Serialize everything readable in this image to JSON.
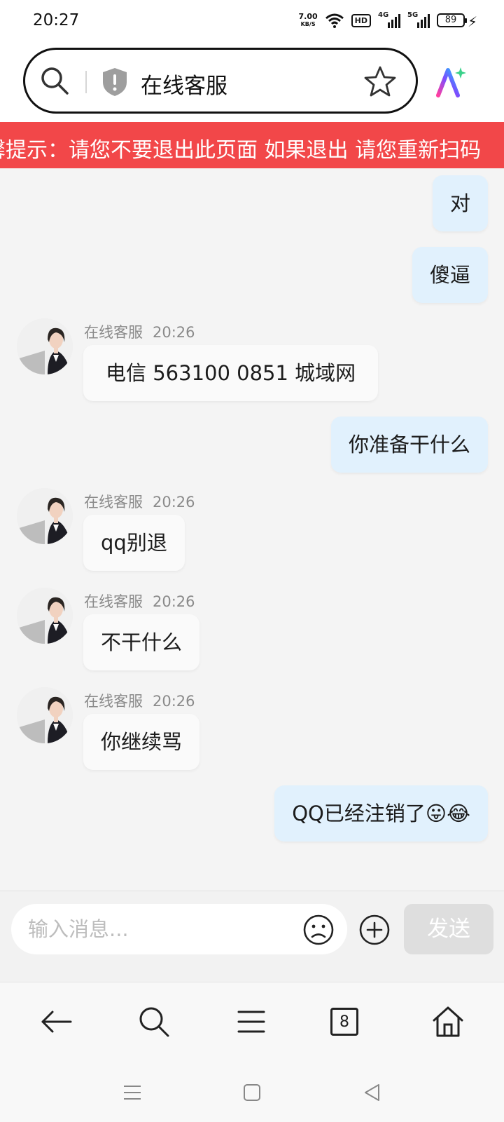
{
  "status_bar": {
    "time": "20:27",
    "net_speed_value": "7.00",
    "net_speed_unit": "KB/S",
    "hd_label": "HD",
    "signal1_label": "4G",
    "signal2_label": "5G",
    "battery": "89"
  },
  "header": {
    "page_title": "在线客服",
    "search_icon": "search-icon",
    "shield_icon": "shield-alert-icon",
    "star_icon": "star-icon",
    "ai_icon": "ai-assistant-icon"
  },
  "marquee": {
    "text": "馨提示：请您不要退出此页面 如果退出 请您重新扫码"
  },
  "colors": {
    "marquee_bg": "#f24749",
    "my_bubble": "#e1f1fd",
    "their_bubble": "#fafafa",
    "send_disabled": "#dedede"
  },
  "chat": {
    "agent_name": "在线客服",
    "messages": [
      {
        "from": "me",
        "text": "对"
      },
      {
        "from": "me",
        "text": "傻逼"
      },
      {
        "from": "agent",
        "name": "在线客服",
        "time": "20:26",
        "text": "电信 563100 0851 城域网"
      },
      {
        "from": "me",
        "text": "你准备干什么"
      },
      {
        "from": "agent",
        "name": "在线客服",
        "time": "20:26",
        "text": "qq别退"
      },
      {
        "from": "agent",
        "name": "在线客服",
        "time": "20:26",
        "text": "不干什么"
      },
      {
        "from": "agent",
        "name": "在线客服",
        "time": "20:26",
        "text": "你继续骂"
      },
      {
        "from": "me",
        "text": "QQ已经注销了😛😂"
      }
    ]
  },
  "input": {
    "placeholder": "输入消息...",
    "send_label": "发送"
  },
  "browser_bar": {
    "tab_count": "8"
  }
}
